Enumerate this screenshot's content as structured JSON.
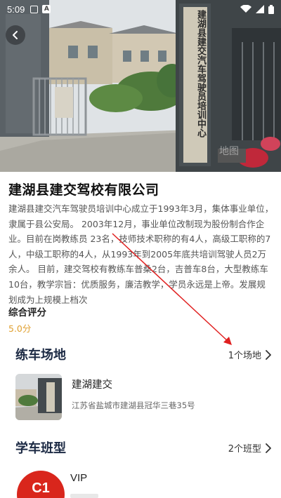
{
  "status_bar": {
    "time": "5:09",
    "icons": [
      "image-icon",
      "a-icon",
      "wifi-icon",
      "signal-icon",
      "battery-icon"
    ]
  },
  "hero": {
    "sign_text": "建湖县建交汽车驾驶员培训中心",
    "watermark": "地图"
  },
  "school": {
    "name": "建湖县建交驾校有限公司",
    "description": "建湖县建交汽车驾驶员培训中心成立于1993年3月，集体事业单位，隶属于县公安局。 2003年12月，事业单位改制现为股份制合作企业。目前在岗教练员 23名，技师技术职称的有4人，高级工职称的7人，中级工职称的4人，从1993年到2005年底共培训驾驶人员2万余人。 目前，建交驾校有教练车普桑2台，吉普车8台，大型教练车10台，教学宗旨：优质服务，廉洁教学，学员永远是上帝。发展规划成为上规模上档次",
    "rating_label": "综合评分",
    "rating_value": "5.0分"
  },
  "practice_section": {
    "title": "练车场地",
    "link": "1个场地",
    "venue": {
      "name": "建湖建交",
      "address": "江苏省盐城市建湖县冠华三巷35号"
    }
  },
  "class_section": {
    "title": "学车班型",
    "link": "2个班型",
    "item": {
      "badge": "C1",
      "name": "VIP"
    }
  },
  "colors": {
    "rating": "#e0a030",
    "section_title": "#1c2a44",
    "badge": "#d9261c",
    "annotation_arrow": "#e02020"
  }
}
